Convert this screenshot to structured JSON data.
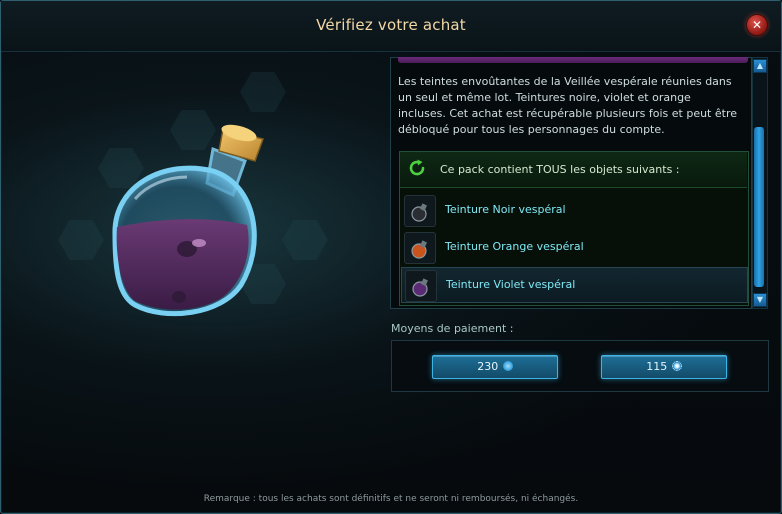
{
  "dialog": {
    "title": "Vérifiez votre achat",
    "close_icon": "close-x-icon"
  },
  "preview": {
    "image_semantic": "potion-flask-purple-dye"
  },
  "description": "Les teintes envoûtantes de la Veillée vespérale réunies dans un seul et même lot. Teintures noire, violet et orange incluses. Cet achat est récupérable plusieurs fois et peut être débloqué pour tous les personnages du compte.",
  "pack": {
    "header": "Ce pack contient TOUS les objets suivants :",
    "header_icon": "refresh-icon",
    "items": [
      {
        "label": "Teinture Noir vespéral",
        "liquid_color": "#2a2e32"
      },
      {
        "label": "Teinture Orange vespéral",
        "liquid_color": "#c8531c"
      },
      {
        "label": "Teinture Violet vespéral",
        "liquid_color": "#5b2a74"
      }
    ],
    "selected_index": 2
  },
  "payment": {
    "label": "Moyens de paiement :",
    "options": [
      {
        "amount": "230",
        "currency_icon": "premium-currency-icon",
        "color": "#3ab0ea"
      },
      {
        "amount": "115",
        "currency_icon": "omnibit-currency-icon",
        "color": "#e8f6ff"
      }
    ]
  },
  "remark": "Remarque : tous les achats sont définitifs et ne seront ni remboursés, ni échangés.",
  "colors": {
    "accent": "#3db4e6",
    "title": "#f2d8a6",
    "item_text": "#7fe8f4"
  }
}
